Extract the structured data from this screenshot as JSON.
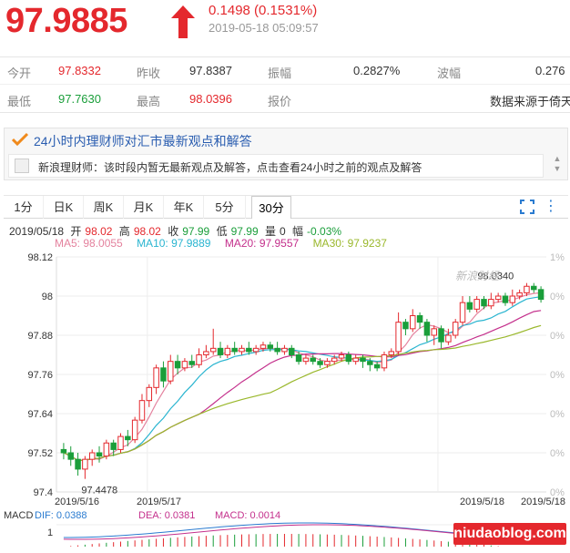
{
  "quote": {
    "price": "97.9885",
    "change": "0.1498 (0.1531%)",
    "timestamp": "2019-05-18 05:09:57"
  },
  "stats": {
    "row1": [
      {
        "label": "今开",
        "value": "97.8332"
      },
      {
        "label": "昨收",
        "value": "97.8387"
      },
      {
        "label": "振幅",
        "value": "0.2827%"
      },
      {
        "label": "波幅",
        "value": "0.276"
      }
    ],
    "row2": [
      {
        "label": "最低",
        "value": "97.7630"
      },
      {
        "label": "最高",
        "value": "98.0396"
      },
      {
        "label": "报价",
        "value": "数据来源于倚天"
      }
    ]
  },
  "advice": {
    "title": "24小时内理财师对汇市最新观点和解答",
    "message": "新浪理财师：该时段内暂无最新观点及解答，点击查看24小时之前的观点及解答"
  },
  "tabs": [
    "1分",
    "日K",
    "周K",
    "月K",
    "年K",
    "5分",
    "30分"
  ],
  "active_tab": "30分",
  "kline_info": {
    "date": "2019/05/18",
    "open_label": "开",
    "open": "98.02",
    "high_label": "高",
    "high": "98.02",
    "close_label": "收",
    "close": "97.99",
    "low_label": "低",
    "low": "97.99",
    "volume_label": "量",
    "volume": "0",
    "amp_label": "幅",
    "amp": "-0.03%"
  },
  "ma_info": {
    "ma5": "MA5: 98.0055",
    "ma10": "MA10: 97.9889",
    "ma20": "MA20: 97.9557",
    "ma30": "MA30: 97.9237"
  },
  "macd_info": {
    "label": "MACD",
    "dif": "DIF: 0.0388",
    "dea": "DEA: 0.0381",
    "macd": "MACD: 0.0014"
  },
  "watermark": "新浪财经",
  "footer_watermark": "niudaoblog.com",
  "colors": {
    "up": "#e4282d",
    "down": "#1a9e3a",
    "ma5": "#e4829e",
    "ma10": "#2ab5d0",
    "ma20": "#c4308c",
    "ma30": "#9ab82c"
  },
  "chart_data": {
    "type": "candlestick",
    "y_ticks": [
      "98.12",
      "98",
      "97.88",
      "97.76",
      "97.64",
      "97.52",
      "97.4"
    ],
    "ylim": [
      97.4,
      98.12
    ],
    "right_ticks": [
      "1%",
      "0%",
      "0%",
      "0%",
      "0%",
      "0%",
      "0%"
    ],
    "x_labels": [
      "2019/5/16",
      "2019/5/17",
      "2019/5/18",
      "2019/5/18"
    ],
    "annotations": [
      {
        "text": "97.4478"
      },
      {
        "text": "98.0340"
      }
    ],
    "macd_axis": [
      "1"
    ],
    "candles": [
      [
        97.53,
        97.52,
        97.55,
        97.5
      ],
      [
        97.52,
        97.5,
        97.54,
        97.48
      ],
      [
        97.5,
        97.47,
        97.52,
        97.45
      ],
      [
        97.47,
        97.5,
        97.51,
        97.44
      ],
      [
        97.5,
        97.52,
        97.53,
        97.48
      ],
      [
        97.52,
        97.51,
        97.54,
        97.49
      ],
      [
        97.51,
        97.55,
        97.56,
        97.5
      ],
      [
        97.55,
        97.53,
        97.56,
        97.51
      ],
      [
        97.53,
        97.57,
        97.58,
        97.52
      ],
      [
        97.57,
        97.56,
        97.59,
        97.54
      ],
      [
        97.56,
        97.62,
        97.63,
        97.55
      ],
      [
        97.62,
        97.68,
        97.7,
        97.61
      ],
      [
        97.68,
        97.72,
        97.73,
        97.66
      ],
      [
        97.72,
        97.78,
        97.79,
        97.7
      ],
      [
        97.78,
        97.74,
        97.8,
        97.72
      ],
      [
        97.74,
        97.8,
        97.82,
        97.73
      ],
      [
        97.8,
        97.78,
        97.82,
        97.76
      ],
      [
        97.78,
        97.8,
        97.81,
        97.77
      ],
      [
        97.8,
        97.79,
        97.82,
        97.78
      ],
      [
        97.79,
        97.82,
        97.84,
        97.78
      ],
      [
        97.82,
        97.83,
        97.85,
        97.81
      ],
      [
        97.83,
        97.84,
        97.9,
        97.82
      ],
      [
        97.84,
        97.82,
        97.86,
        97.81
      ],
      [
        97.82,
        97.84,
        97.85,
        97.81
      ],
      [
        97.84,
        97.83,
        97.86,
        97.82
      ],
      [
        97.83,
        97.84,
        97.85,
        97.82
      ],
      [
        97.84,
        97.83,
        97.86,
        97.82
      ],
      [
        97.83,
        97.84,
        97.85,
        97.82
      ],
      [
        97.84,
        97.85,
        97.86,
        97.83
      ],
      [
        97.85,
        97.84,
        97.86,
        97.83
      ],
      [
        97.84,
        97.83,
        97.86,
        97.82
      ],
      [
        97.83,
        97.84,
        97.85,
        97.82
      ],
      [
        97.84,
        97.82,
        97.85,
        97.81
      ],
      [
        97.82,
        97.8,
        97.83,
        97.79
      ],
      [
        97.8,
        97.81,
        97.82,
        97.79
      ],
      [
        97.81,
        97.8,
        97.82,
        97.79
      ],
      [
        97.8,
        97.79,
        97.81,
        97.78
      ],
      [
        97.79,
        97.8,
        97.81,
        97.78
      ],
      [
        97.8,
        97.81,
        97.82,
        97.79
      ],
      [
        97.81,
        97.82,
        97.83,
        97.8
      ],
      [
        97.82,
        97.8,
        97.83,
        97.79
      ],
      [
        97.8,
        97.81,
        97.82,
        97.79
      ],
      [
        97.81,
        97.8,
        97.82,
        97.78
      ],
      [
        97.8,
        97.79,
        97.81,
        97.77
      ],
      [
        97.79,
        97.78,
        97.8,
        97.77
      ],
      [
        97.78,
        97.82,
        97.83,
        97.77
      ],
      [
        97.82,
        97.83,
        97.84,
        97.81
      ],
      [
        97.83,
        97.92,
        97.95,
        97.82
      ],
      [
        97.92,
        97.9,
        97.93,
        97.88
      ],
      [
        97.9,
        97.94,
        97.96,
        97.89
      ],
      [
        97.94,
        97.92,
        97.95,
        97.9
      ],
      [
        97.92,
        97.88,
        97.93,
        97.86
      ],
      [
        97.88,
        97.9,
        97.91,
        97.85
      ],
      [
        97.9,
        97.86,
        97.91,
        97.84
      ],
      [
        97.86,
        97.88,
        97.9,
        97.85
      ],
      [
        97.88,
        97.92,
        97.93,
        97.87
      ],
      [
        97.92,
        97.98,
        98.0,
        97.91
      ],
      [
        97.98,
        97.96,
        98.0,
        97.95
      ],
      [
        97.96,
        97.99,
        98.0,
        97.95
      ],
      [
        97.99,
        97.97,
        98.0,
        97.96
      ],
      [
        97.97,
        97.99,
        98.01,
        97.96
      ],
      [
        97.99,
        98.0,
        98.01,
        97.98
      ],
      [
        98.0,
        97.98,
        98.01,
        97.97
      ],
      [
        97.98,
        98.0,
        98.02,
        97.97
      ],
      [
        98.0,
        98.01,
        98.02,
        97.99
      ],
      [
        98.01,
        98.03,
        98.04,
        98.0
      ],
      [
        98.03,
        98.02,
        98.04,
        98.01
      ],
      [
        98.02,
        97.99,
        98.03,
        97.98
      ]
    ]
  }
}
